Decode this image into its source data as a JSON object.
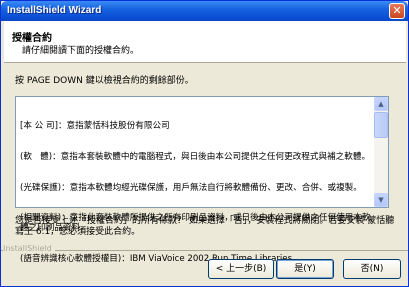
{
  "window": {
    "title": "InstallShield Wizard",
    "close_glyph": "✕"
  },
  "header": {
    "title": "授權合約",
    "subtitle": "請仔細閱讀下面的授權合約。"
  },
  "instruction": "按 PAGE DOWN 鍵以檢視合約的剩餘部份。",
  "license": {
    "lines": [
      "[本 公 司]：意指蒙恬科技股份有限公司",
      "(軟   體)：意指本套裝軟體中的電腦程式，與日後由本公司提供之任何更改程式與補之軟體。",
      "(光碟保護)：意指本軟體均經光碟保護，用戶無法自行將軟體備份、更改、合併、或複製。",
      "(相關資料)：意指此套裝軟體所提供之所有印刷品資料，或日後由本公司提供之任何使用本軟體之印刷品資料。",
      "(語音辨識核心軟體授權目)：IBM ViaVoice 2002 Run Time Libraries"
    ]
  },
  "question": "您是否接受上述「授權合約」的所有條款？  如果選擇「否」，安裝程式將關閉。若要安裝 蒙恬聽寫王 6.1，您必須接受此合約。",
  "brand": "InstallShield",
  "buttons": {
    "back": "< 上一步(B)",
    "yes": "是(Y)",
    "no": "否(N)"
  },
  "scrollbar": {
    "up_glyph": "▲",
    "down_glyph": "▼"
  }
}
